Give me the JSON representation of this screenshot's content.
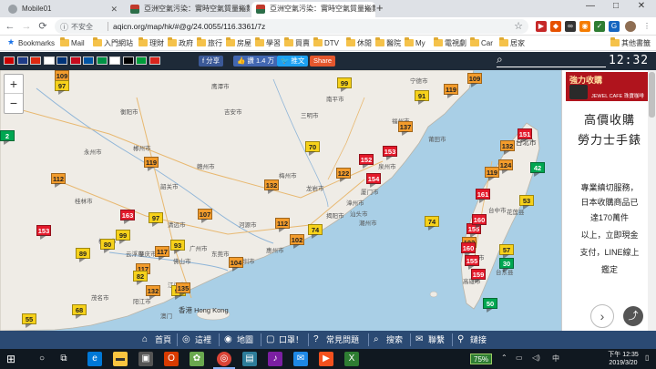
{
  "browser": {
    "tabs": [
      {
        "label": "Mobile01",
        "active": false
      },
      {
        "label": "亞洲空氣污染：實時空氣質量指數",
        "active": false
      },
      {
        "label": "亞洲空氣污染：實時空氣質量指數",
        "active": true
      }
    ],
    "new_tab": "+",
    "window_buttons": [
      "—",
      "□",
      "✕"
    ],
    "nav": {
      "back": "←",
      "forward": "→",
      "reload": "⟳"
    },
    "security_label": "不安全",
    "url": "aqicn.org/map/hk/#@g/24.0055/116.3361/7z",
    "bookmarks": [
      {
        "label": "Bookmarks",
        "star": true
      },
      {
        "label": "Mail"
      },
      {
        "label": "入門網站"
      },
      {
        "label": "理財"
      },
      {
        "label": "政府"
      },
      {
        "label": "旅行"
      },
      {
        "label": "房屋"
      },
      {
        "label": "學習"
      },
      {
        "label": "買賣"
      },
      {
        "label": "DTV"
      },
      {
        "label": "休閒"
      },
      {
        "label": "醫院"
      },
      {
        "label": "My"
      },
      {
        "label": "電視劇"
      },
      {
        "label": "Car"
      },
      {
        "label": "居家"
      },
      {
        "label": "其他書籤"
      }
    ]
  },
  "site": {
    "share_buttons": [
      {
        "label": "f 分享",
        "color": "#3b5998"
      },
      {
        "label": "👍 讚 1.4 万",
        "color": "#4267b2"
      },
      {
        "label": "🐦 推文",
        "color": "#1da1f2"
      },
      {
        "label": "Share",
        "color": "#e4572e"
      }
    ],
    "flags": [
      "#cc0000",
      "#1f3c88",
      "#de2910",
      "#ffffff",
      "#003478",
      "#c60b1e",
      "#0055a4",
      "#009246",
      "#ffffff",
      "#000000",
      "#009c3b",
      "#da251d"
    ],
    "clock": "12:32",
    "zoom_in": "+",
    "zoom_out": "−"
  },
  "map": {
    "stations": [
      {
        "aqi": 109,
        "level": "sensitive"
      },
      {
        "aqi": 97,
        "level": "moderate"
      },
      {
        "aqi": 99,
        "level": "moderate"
      },
      {
        "aqi": 91,
        "level": "moderate"
      },
      {
        "aqi": 119,
        "level": "sensitive"
      },
      {
        "aqi": 109,
        "level": "sensitive"
      },
      {
        "aqi": 137,
        "level": "sensitive"
      },
      {
        "aqi": 70,
        "level": "moderate"
      },
      {
        "aqi": 153,
        "level": "unhealthy"
      },
      {
        "aqi": 152,
        "level": "unhealthy"
      },
      {
        "aqi": 122,
        "level": "sensitive"
      },
      {
        "aqi": 154,
        "level": "unhealthy"
      },
      {
        "aqi": 119,
        "level": "sensitive"
      },
      {
        "aqi": 112,
        "level": "sensitive"
      },
      {
        "aqi": 132,
        "level": "sensitive"
      },
      {
        "aqi": 163,
        "level": "unhealthy"
      },
      {
        "aqi": 97,
        "level": "moderate"
      },
      {
        "aqi": 107,
        "level": "sensitive"
      },
      {
        "aqi": 153,
        "level": "unhealthy"
      },
      {
        "aqi": 99,
        "level": "moderate"
      },
      {
        "aqi": 112,
        "level": "sensitive"
      },
      {
        "aqi": 117,
        "level": "sensitive"
      },
      {
        "aqi": 102,
        "level": "sensitive"
      },
      {
        "aqi": 74,
        "level": "moderate"
      },
      {
        "aqi": 80,
        "level": "moderate"
      },
      {
        "aqi": 89,
        "level": "moderate"
      },
      {
        "aqi": 93,
        "level": "moderate"
      },
      {
        "aqi": 117,
        "level": "sensitive"
      },
      {
        "aqi": 104,
        "level": "sensitive"
      },
      {
        "aqi": 82,
        "level": "moderate"
      },
      {
        "aqi": 99,
        "level": "moderate"
      },
      {
        "aqi": 132,
        "level": "sensitive"
      },
      {
        "aqi": 135,
        "level": "sensitive"
      },
      {
        "aqi": 68,
        "level": "moderate"
      },
      {
        "aqi": 55,
        "level": "moderate"
      },
      {
        "aqi": 74,
        "level": "moderate"
      },
      {
        "aqi": 151,
        "level": "unhealthy"
      },
      {
        "aqi": 132,
        "level": "sensitive"
      },
      {
        "aqi": 119,
        "level": "sensitive"
      },
      {
        "aqi": 124,
        "level": "sensitive"
      },
      {
        "aqi": 42,
        "level": "good"
      },
      {
        "aqi": 161,
        "level": "unhealthy"
      },
      {
        "aqi": 53,
        "level": "moderate"
      },
      {
        "aqi": 155,
        "level": "unhealthy"
      },
      {
        "aqi": 160,
        "level": "unhealthy"
      },
      {
        "aqi": 102,
        "level": "sensitive"
      },
      {
        "aqi": 160,
        "level": "unhealthy"
      },
      {
        "aqi": 57,
        "level": "moderate"
      },
      {
        "aqi": 30,
        "level": "good"
      },
      {
        "aqi": 155,
        "level": "unhealthy"
      },
      {
        "aqi": 159,
        "level": "unhealthy"
      },
      {
        "aqi": 50,
        "level": "good"
      },
      {
        "aqi": 2,
        "level": "good"
      }
    ],
    "cities": [
      "鹰潭市",
      "南平市",
      "福州市",
      "三明市",
      "莆田市",
      "泉州市",
      "厦门市",
      "漳州市",
      "龙岩市",
      "赣州市",
      "梅州市",
      "汕头市",
      "揭阳市",
      "潮州市",
      "河源市",
      "惠州市",
      "深圳市",
      "东莞市",
      "广州市",
      "佛山市",
      "江门市",
      "肇庆市",
      "清远市",
      "韶关市",
      "郴州市",
      "永州市",
      "桂林市",
      "梧州市",
      "云浮市",
      "茂名市",
      "阳江市",
      "香港 Hong Kong",
      "澳门",
      "台北市",
      "台中市",
      "台南市",
      "高雄市",
      "花莲县",
      "台东县",
      "衡阳市",
      "宁德市",
      "吉安市"
    ]
  },
  "ad": {
    "banner_title": "強力收購",
    "banner_sub": "JEWEL CAFE 珠寶咖啡",
    "headline1": "高價收購",
    "headline2": "勞力士手錶",
    "lines": [
      "專業縝切服務，",
      "日本收購商品已",
      "達170萬件",
      "以上，立即現金",
      "支付，LINE線上",
      "鑑定"
    ],
    "next": "›",
    "share_icon": "⤴"
  },
  "site_nav": [
    {
      "label": "首頁",
      "icon": "⌂"
    },
    {
      "label": "這裡",
      "icon": "◎"
    },
    {
      "label": "地圖",
      "icon": "◉"
    },
    {
      "label": "口罩！",
      "icon": "▢"
    },
    {
      "label": "常見問題",
      "icon": "?"
    },
    {
      "label": "搜索",
      "icon": "⌕"
    },
    {
      "label": "聯繫",
      "icon": "✉"
    },
    {
      "label": "鏈接",
      "icon": "⚲"
    }
  ],
  "taskbar": {
    "zoom": "75%",
    "time": "下午 12:35",
    "date": "2019/3/20",
    "ime": "中"
  }
}
